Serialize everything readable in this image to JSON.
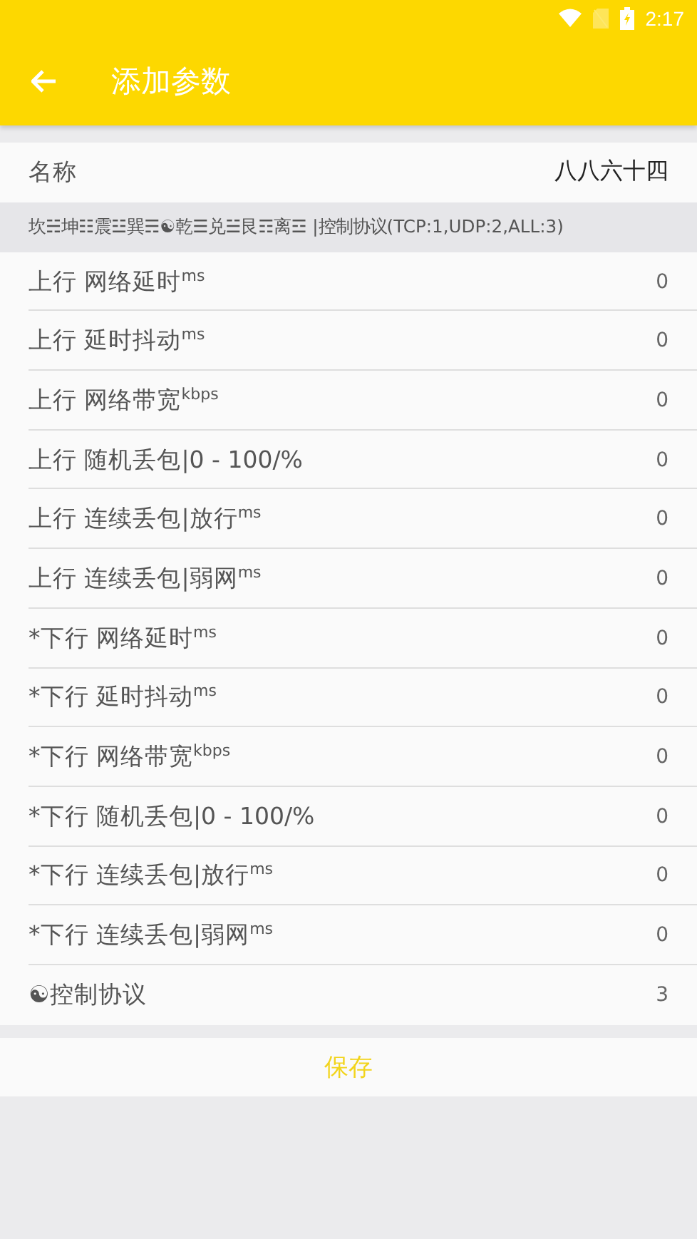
{
  "status_bar": {
    "time": "2:17"
  },
  "toolbar": {
    "title": "添加参数"
  },
  "name_field": {
    "label": "名称",
    "value": "八八六十四"
  },
  "hint": "坎☵坤☷震☳巽☴☯乾☰兑☱艮☶离☲ |控制协议(TCP:1,UDP:2,ALL:3)",
  "params": [
    {
      "label": "上行 网络延时$^{ms}$",
      "value": "0"
    },
    {
      "label": "上行 延时抖动$^{ms}$",
      "value": "0"
    },
    {
      "label": "上行 网络带宽$^{kbps}$",
      "value": "0"
    },
    {
      "label": "上行 随机丢包|0 - 100/%",
      "value": "0"
    },
    {
      "label": "上行 连续丢包|放行$^{ms}$",
      "value": "0"
    },
    {
      "label": "上行 连续丢包|弱网$^{ms}$",
      "value": "0"
    },
    {
      "label": "*下行 网络延时$^{ms}$",
      "value": "0"
    },
    {
      "label": "*下行 延时抖动$^{ms}$",
      "value": "0"
    },
    {
      "label": "*下行 网络带宽$^{kbps}$",
      "value": "0"
    },
    {
      "label": "*下行 随机丢包|0 - 100/%",
      "value": "0"
    },
    {
      "label": "*下行 连续丢包|放行$^{ms}$",
      "value": "0"
    },
    {
      "label": "*下行 连续丢包|弱网$^{ms}$",
      "value": "0"
    },
    {
      "label": "☯控制协议",
      "value": "3"
    }
  ],
  "save_button": "保存"
}
